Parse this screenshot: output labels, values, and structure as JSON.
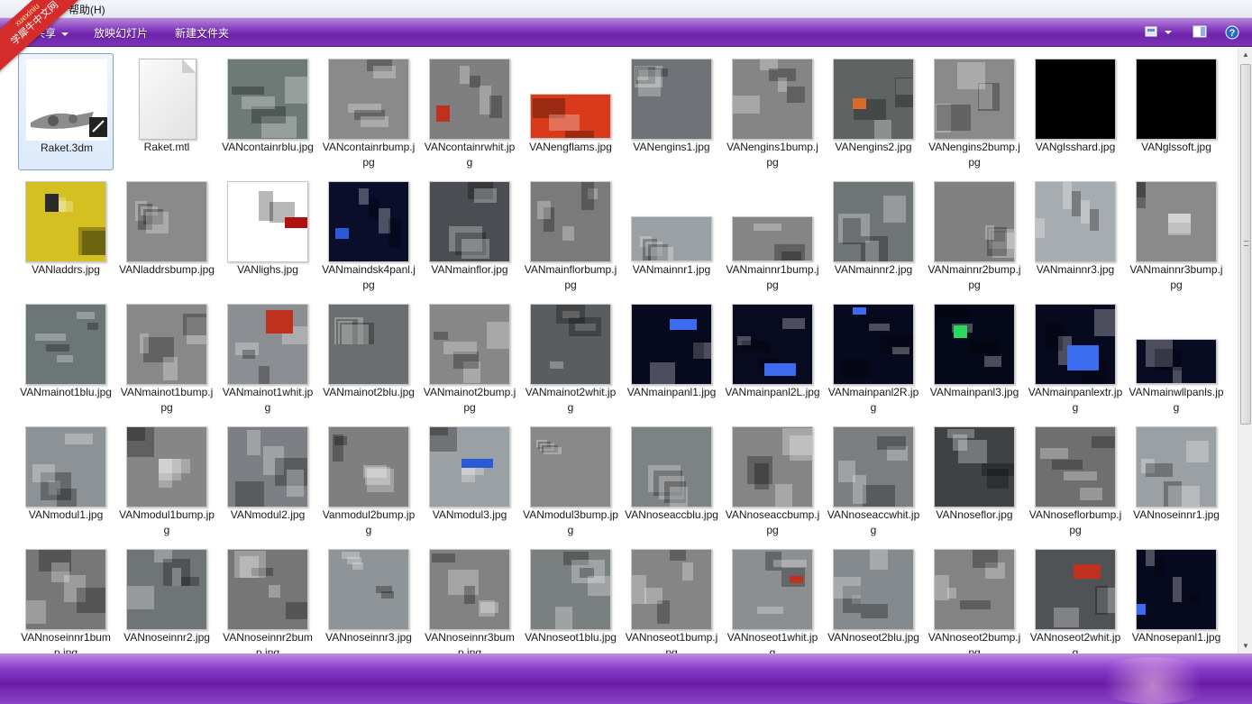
{
  "menubar": {
    "help": "帮助(H)"
  },
  "toolbar": {
    "share": "共享",
    "slideshow": "放映幻灯片",
    "new_folder": "新建文件夹",
    "accent": "#7a36b8"
  },
  "watermark": {
    "line1": "xuexiniu",
    "line2": "学犀牛中文网"
  },
  "files": [
    {
      "name": "Raket.3dm",
      "kind": "model",
      "selected": true
    },
    {
      "name": "Raket.mtl",
      "kind": "doc"
    },
    {
      "name": "VANcontainrblu.jpg",
      "kind": "img",
      "color": "#6e7a76"
    },
    {
      "name": "VANcontainrbump.jpg",
      "kind": "img",
      "color": "#8a8a8a"
    },
    {
      "name": "VANcontainrwhit.jpg",
      "kind": "img",
      "color": "#7f7f7f",
      "accent": "#c0301e"
    },
    {
      "name": "VANengflams.jpg",
      "kind": "img",
      "color": "#d93a1a",
      "short": true
    },
    {
      "name": "VANengins1.jpg",
      "kind": "img",
      "color": "#6f7276"
    },
    {
      "name": "VANengins1bump.jpg",
      "kind": "img",
      "color": "#858585"
    },
    {
      "name": "VANengins2.jpg",
      "kind": "img",
      "color": "#5f6462",
      "accent": "#d86a2a"
    },
    {
      "name": "VANengins2bump.jpg",
      "kind": "img",
      "color": "#8a8a8a"
    },
    {
      "name": "VANglsshard.jpg",
      "kind": "img",
      "color": "#000000"
    },
    {
      "name": "VANglssoft.jpg",
      "kind": "img",
      "color": "#000000"
    },
    {
      "name": "VANladdrs.jpg",
      "kind": "img",
      "color": "#d4c020",
      "accent": "#2a2a2a"
    },
    {
      "name": "VANladdrsbump.jpg",
      "kind": "img",
      "color": "#8a8a8a"
    },
    {
      "name": "VANlighs.jpg",
      "kind": "img",
      "color": "#ffffff",
      "accent": "#b01010"
    },
    {
      "name": "VANmaindsk4panl.jpg",
      "kind": "img",
      "color": "#0a0e2a",
      "accent": "#2a5ad8"
    },
    {
      "name": "VANmainflor.jpg",
      "kind": "img",
      "color": "#4a4d52"
    },
    {
      "name": "VANmainflorbump.jpg",
      "kind": "img",
      "color": "#7a7a7a"
    },
    {
      "name": "VANmainnr1.jpg",
      "kind": "img",
      "color": "#9aa0a4",
      "short": true
    },
    {
      "name": "VANmainnr1bump.jpg",
      "kind": "img",
      "color": "#858585",
      "short": true
    },
    {
      "name": "VANmainnr2.jpg",
      "kind": "img",
      "color": "#6f7476"
    },
    {
      "name": "VANmainnr2bump.jpg",
      "kind": "img",
      "color": "#808080"
    },
    {
      "name": "VANmainnr3.jpg",
      "kind": "img",
      "color": "#a7acb0"
    },
    {
      "name": "VANmainnr3bump.jpg",
      "kind": "img",
      "color": "#8a8a8a"
    },
    {
      "name": "VANmainot1blu.jpg",
      "kind": "img",
      "color": "#6d7677"
    },
    {
      "name": "VANmainot1bump.jpg",
      "kind": "img",
      "color": "#888888"
    },
    {
      "name": "VANmainot1whit.jpg",
      "kind": "img",
      "color": "#8b8e93",
      "accent": "#c0301e"
    },
    {
      "name": "VANmainot2blu.jpg",
      "kind": "img",
      "color": "#6b6e70"
    },
    {
      "name": "VANmainot2bump.jpg",
      "kind": "img",
      "color": "#878787"
    },
    {
      "name": "VANmainot2whit.jpg",
      "kind": "img",
      "color": "#5a5d60"
    },
    {
      "name": "VANmainpanl1.jpg",
      "kind": "img",
      "color": "#070a1f",
      "accent": "#3b6cf0"
    },
    {
      "name": "VANmainpanl2L.jpg",
      "kind": "img",
      "color": "#080b20",
      "accent": "#3b6cf0"
    },
    {
      "name": "VANmainpanl2R.jpg",
      "kind": "img",
      "color": "#070a1f",
      "accent": "#3b6cf0"
    },
    {
      "name": "VANmainpanl3.jpg",
      "kind": "img",
      "color": "#050818",
      "accent": "#2ad860"
    },
    {
      "name": "VANmainpanlextr.jpg",
      "kind": "img",
      "color": "#070a1f",
      "accent": "#3b6cf0"
    },
    {
      "name": "VANmainwllpanls.jpg",
      "kind": "img",
      "color": "#080b22",
      "accent": "#3b6cf0",
      "short": true
    },
    {
      "name": "VANmodul1.jpg",
      "kind": "img",
      "color": "#8d9296"
    },
    {
      "name": "VANmodul1bump.jpg",
      "kind": "img",
      "color": "#868686"
    },
    {
      "name": "VANmodul2.jpg",
      "kind": "img",
      "color": "#7c8084"
    },
    {
      "name": "Vanmodul2bump.jpg",
      "kind": "img",
      "color": "#7f7f7f"
    },
    {
      "name": "VANmodul3.jpg",
      "kind": "img",
      "color": "#9ba0a4",
      "accent": "#2a5ad8"
    },
    {
      "name": "VANmodul3bump.jpg",
      "kind": "img",
      "color": "#888888"
    },
    {
      "name": "VANnoseaccblu.jpg",
      "kind": "img",
      "color": "#7d8284"
    },
    {
      "name": "VANnoseaccbump.jpg",
      "kind": "img",
      "color": "#858585"
    },
    {
      "name": "VANnoseaccwhit.jpg",
      "kind": "img",
      "color": "#7b7f82"
    },
    {
      "name": "VANnoseflor.jpg",
      "kind": "img",
      "color": "#3f4245"
    },
    {
      "name": "VANnoseflorbump.jpg",
      "kind": "img",
      "color": "#6f6f6f"
    },
    {
      "name": "VANnoseinnr1.jpg",
      "kind": "img",
      "color": "#9aa0a4"
    },
    {
      "name": "VANnoseinnr1bump.jpg",
      "kind": "img",
      "color": "#777777"
    },
    {
      "name": "VANnoseinnr2.jpg",
      "kind": "img",
      "color": "#6f7477"
    },
    {
      "name": "VANnoseinnr2bump.jpg",
      "kind": "img",
      "color": "#767676"
    },
    {
      "name": "VANnoseinnr3.jpg",
      "kind": "img",
      "color": "#8f9498"
    },
    {
      "name": "VANnoseinnr3bump.jpg",
      "kind": "img",
      "color": "#828282"
    },
    {
      "name": "VANnoseot1blu.jpg",
      "kind": "img",
      "color": "#7a8080"
    },
    {
      "name": "VANnoseot1bump.jpg",
      "kind": "img",
      "color": "#858585"
    },
    {
      "name": "VANnoseot1whit.jpg",
      "kind": "img",
      "color": "#8b8f92",
      "accent": "#c0301e"
    },
    {
      "name": "VANnoseot2blu.jpg",
      "kind": "img",
      "color": "#858a8e"
    },
    {
      "name": "VANnoseot2bump.jpg",
      "kind": "img",
      "color": "#838383"
    },
    {
      "name": "VANnoseot2whit.jpg",
      "kind": "img",
      "color": "#4f5356",
      "accent": "#c0301e"
    },
    {
      "name": "VANnosepanl1.jpg",
      "kind": "img",
      "color": "#070a1f",
      "accent": "#3b6cf0"
    }
  ]
}
